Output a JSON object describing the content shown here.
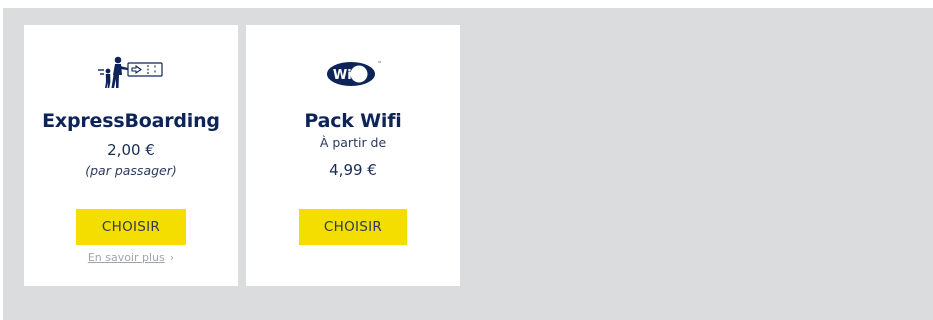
{
  "cards": [
    {
      "title": "ExpressBoarding",
      "price": "2,00 €",
      "subtext": "(par passager)",
      "button_label": "CHOISIR",
      "link_label": "En savoir plus",
      "link_chevron": "›",
      "icon": "express-boarding-icon"
    },
    {
      "title": "Pack Wifi",
      "subtext": "À partir de",
      "price": "4,99 €",
      "button_label": "CHOISIR",
      "icon": "wifi-icon",
      "icon_text": "WiFi",
      "icon_tm": "™"
    }
  ],
  "colors": {
    "panel_bg": "#dbdcde",
    "card_bg": "#ffffff",
    "brand_navy": "#0e2459",
    "button_yellow": "#f4de00",
    "link_gray": "#a0a4ad"
  }
}
